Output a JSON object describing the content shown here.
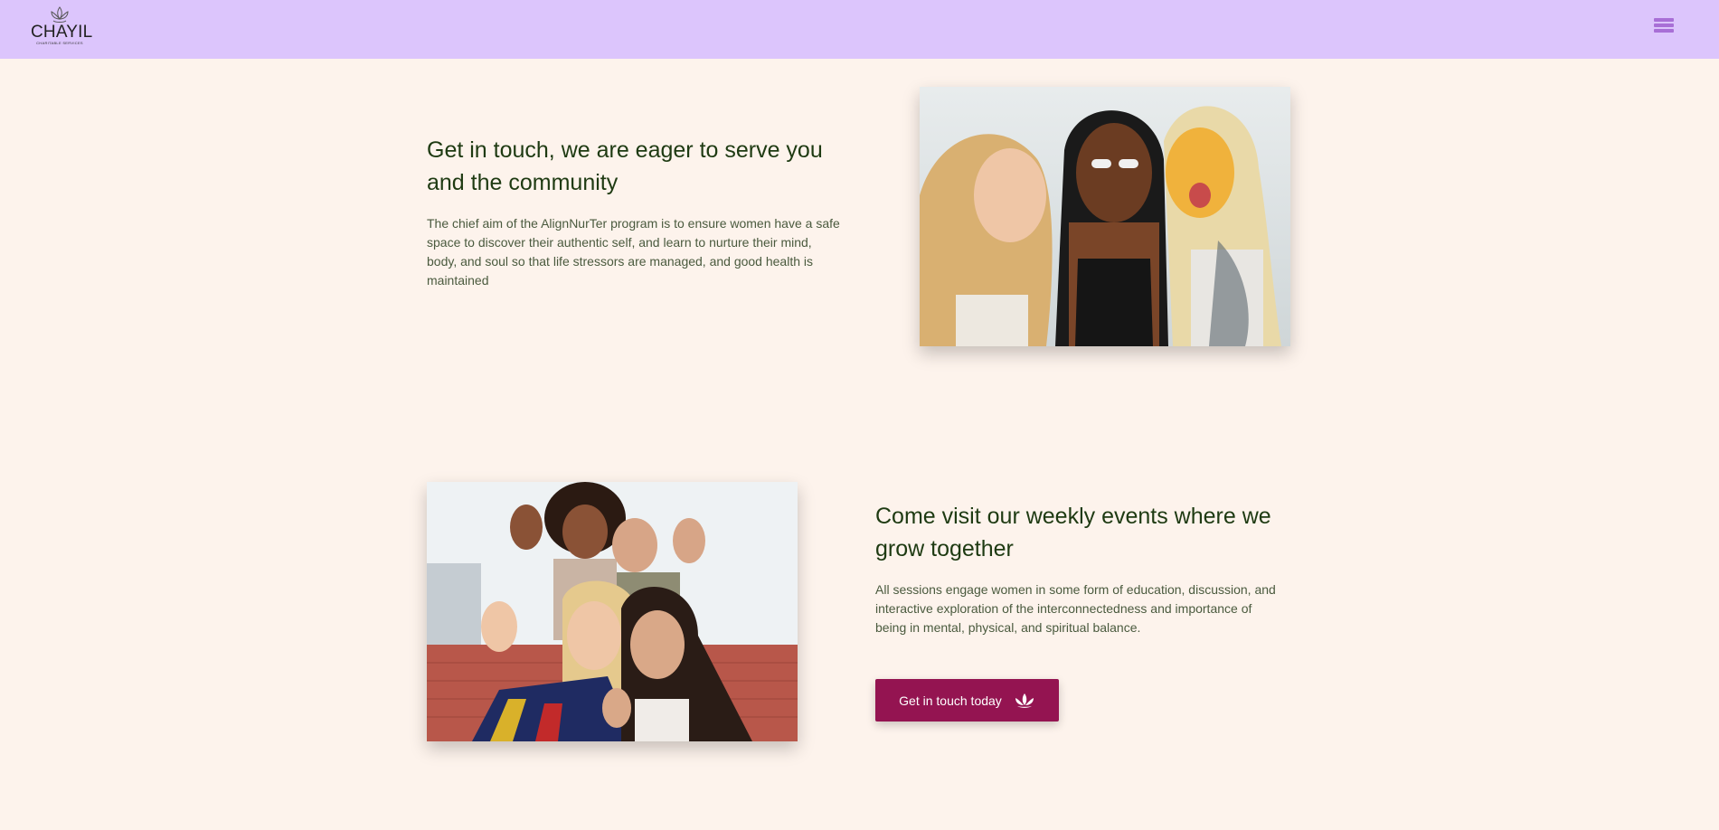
{
  "header": {
    "brand": "CHAYIL",
    "brand_sub": "CHARITABLE SERVICES",
    "menu_icon": "hamburger-menu-icon",
    "colors": {
      "background": "#dcc5fc",
      "menu": "#a86fd6"
    }
  },
  "section1": {
    "title_line1": "Get in touch, we are eager to serve you",
    "title_line2": "and the community",
    "text_lines": [
      "The chief aim of the AlignNurTer program is to ensure women have a safe",
      "space to discover their authentic self, and learn to nurture their mind,",
      "body, and soul so that life stressors are managed, and good health is",
      "maintained"
    ]
  },
  "section2": {
    "title_line1": "Come visit our weekly events where we",
    "title_line2": "grow together",
    "text_lines": [
      "All sessions engage women in some form of education, discussion, and",
      "interactive exploration of the interconnectedness and importance of",
      "being in mental, physical, and spiritual balance."
    ],
    "button_label": "Get in touch today",
    "button_icon": "lotus-icon"
  },
  "colors": {
    "page_background": "#fdf3ec",
    "heading": "#1e3a12",
    "body_text": "#4a5a3e",
    "button": "#941451"
  }
}
